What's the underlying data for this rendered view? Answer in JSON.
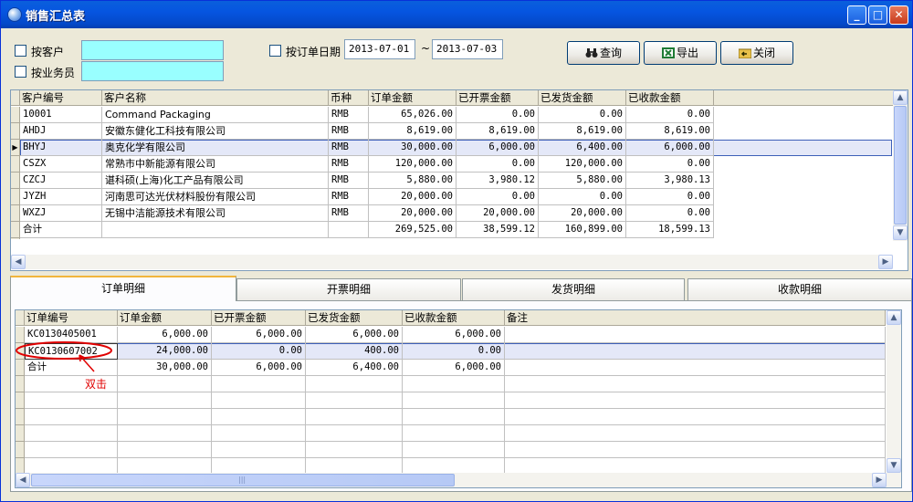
{
  "window": {
    "title": "销售汇总表"
  },
  "filters": {
    "by_customer_label": "按客户",
    "by_salesperson_label": "按业务员",
    "by_order_date_label": "按订单日期",
    "date_from": "2013-07-01",
    "date_separator": "~",
    "date_to": "2013-07-03"
  },
  "toolbar": {
    "query_label": "查询",
    "export_label": "导出",
    "close_label": "关闭"
  },
  "summary_table": {
    "columns": [
      "客户编号",
      "客户名称",
      "币种",
      "订单金额",
      "已开票金额",
      "已发货金额",
      "已收款金额"
    ],
    "rows": [
      [
        "10001",
        "Command Packaging",
        "RMB",
        "65,026.00",
        "0.00",
        "0.00",
        "0.00"
      ],
      [
        "AHDJ",
        "安徽东健化工科技有限公司",
        "RMB",
        "8,619.00",
        "8,619.00",
        "8,619.00",
        "8,619.00"
      ],
      [
        "BHYJ",
        "奥克化学有限公司",
        "RMB",
        "30,000.00",
        "6,000.00",
        "6,400.00",
        "6,000.00"
      ],
      [
        "CSZX",
        "常熟市中新能源有限公司",
        "RMB",
        "120,000.00",
        "0.00",
        "120,000.00",
        "0.00"
      ],
      [
        "CZCJ",
        "谌科硕(上海)化工产品有限公司",
        "RMB",
        "5,880.00",
        "3,980.12",
        "5,880.00",
        "3,980.13"
      ],
      [
        "JYZH",
        "河南思可达光伏材料股份有限公司",
        "RMB",
        "20,000.00",
        "0.00",
        "0.00",
        "0.00"
      ],
      [
        "WXZJ",
        "无锡中洁能源技术有限公司",
        "RMB",
        "20,000.00",
        "20,000.00",
        "20,000.00",
        "0.00"
      ],
      [
        "合计",
        "",
        "",
        "269,525.00",
        "38,599.12",
        "160,899.00",
        "18,599.13"
      ]
    ]
  },
  "tabs": [
    "订单明细",
    "开票明细",
    "发货明细",
    "收款明细"
  ],
  "detail_table": {
    "columns": [
      "订单编号",
      "订单金额",
      "已开票金额",
      "已发货金额",
      "已收款金额",
      "备注"
    ],
    "rows": [
      [
        "KC0130405001",
        "6,000.00",
        "6,000.00",
        "6,000.00",
        "6,000.00",
        ""
      ],
      [
        "KC0130607002",
        "24,000.00",
        "0.00",
        "400.00",
        "0.00",
        ""
      ],
      [
        "合计",
        "30,000.00",
        "6,000.00",
        "6,400.00",
        "6,000.00",
        ""
      ]
    ]
  },
  "annotation": {
    "text": "双击",
    "color": "#e00000"
  }
}
